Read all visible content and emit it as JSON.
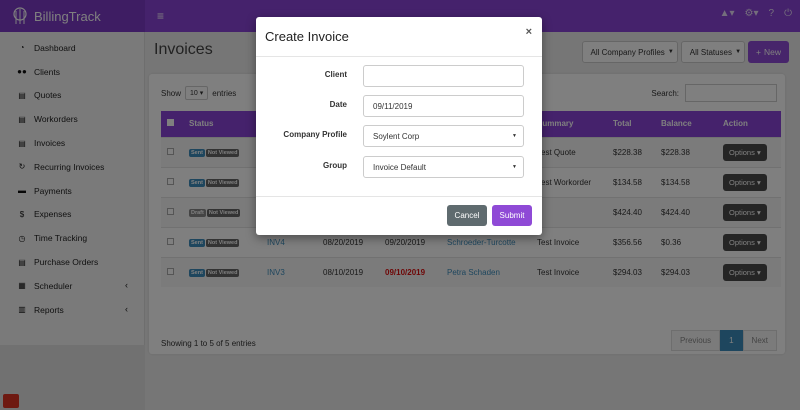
{
  "app": {
    "name": "BillingTrack",
    "brand_color": "#8a44d8"
  },
  "topbar": {
    "icons": [
      "hamburger-icon",
      "building-icon",
      "gear-icon",
      "question-icon",
      "power-icon"
    ]
  },
  "sidebar": {
    "items": [
      {
        "label": "Dashboard",
        "icon": "dashboard-icon",
        "glyph": "◔"
      },
      {
        "label": "Clients",
        "icon": "users-icon",
        "glyph": "👥"
      },
      {
        "label": "Quotes",
        "icon": "file-icon",
        "glyph": "▤"
      },
      {
        "label": "Workorders",
        "icon": "file-icon",
        "glyph": "▤"
      },
      {
        "label": "Invoices",
        "icon": "file-icon",
        "glyph": "▤"
      },
      {
        "label": "Recurring Invoices",
        "icon": "refresh-icon",
        "glyph": "↻"
      },
      {
        "label": "Payments",
        "icon": "credit-card-icon",
        "glyph": "▬"
      },
      {
        "label": "Expenses",
        "icon": "dollar-icon",
        "glyph": "$"
      },
      {
        "label": "Time Tracking",
        "icon": "clock-icon",
        "glyph": "◷"
      },
      {
        "label": "Purchase Orders",
        "icon": "file-icon",
        "glyph": "▤"
      },
      {
        "label": "Scheduler",
        "icon": "calendar-icon",
        "glyph": "▦"
      },
      {
        "label": "Reports",
        "icon": "chart-icon",
        "glyph": "▥"
      }
    ]
  },
  "page": {
    "title": "Invoices",
    "company_filter": "All Company Profiles",
    "status_filter": "All Statuses",
    "new_label": "New"
  },
  "table": {
    "show_label": "Show",
    "entries_value": "10",
    "entries_label": "entries",
    "search_label": "Search:",
    "columns": [
      "Status",
      "",
      "",
      "",
      "",
      "Summary",
      "Total",
      "Balance",
      "Action"
    ],
    "rows": [
      {
        "status": "Sent",
        "viewed": "Not Viewed",
        "number": "",
        "date": "",
        "due": "",
        "client": "",
        "summary": "Test Quote",
        "total": "$228.38",
        "balance": "$228.38",
        "action": "Options"
      },
      {
        "status": "Sent",
        "viewed": "Not Viewed",
        "number": "",
        "date": "",
        "due": "",
        "client": "",
        "summary": "Test Workorder",
        "total": "$134.58",
        "balance": "$134.58",
        "action": "Options"
      },
      {
        "status": "Draft",
        "viewed": "Not Viewed",
        "number": "",
        "date": "",
        "due": "",
        "client": "",
        "summary": "",
        "total": "$424.40",
        "balance": "$424.40",
        "action": "Options"
      },
      {
        "status": "Sent",
        "viewed": "Not Viewed",
        "number": "INV4",
        "date": "08/20/2019",
        "due": "09/20/2019",
        "client": "Schroeder-Turcotte",
        "summary": "Test Invoice",
        "total": "$356.56",
        "balance": "$0.36",
        "action": "Options"
      },
      {
        "status": "Sent",
        "viewed": "Not Viewed",
        "number": "INV3",
        "date": "08/10/2019",
        "due": "09/10/2019",
        "client": "Petra Schaden",
        "summary": "Test Invoice",
        "total": "$294.03",
        "balance": "$294.03",
        "action": "Options"
      }
    ],
    "showing_text": "Showing 1 to 5 of 5 entries",
    "pager": {
      "previous": "Previous",
      "current": "1",
      "next": "Next"
    }
  },
  "modal": {
    "title": "Create Invoice",
    "close": "×",
    "fields": {
      "client_label": "Client",
      "client_value": "",
      "date_label": "Date",
      "date_value": "09/11/2019",
      "company_label": "Company Profile",
      "company_value": "Soylent Corp",
      "group_label": "Group",
      "group_value": "Invoice Default"
    },
    "cancel_label": "Cancel",
    "submit_label": "Submit"
  }
}
